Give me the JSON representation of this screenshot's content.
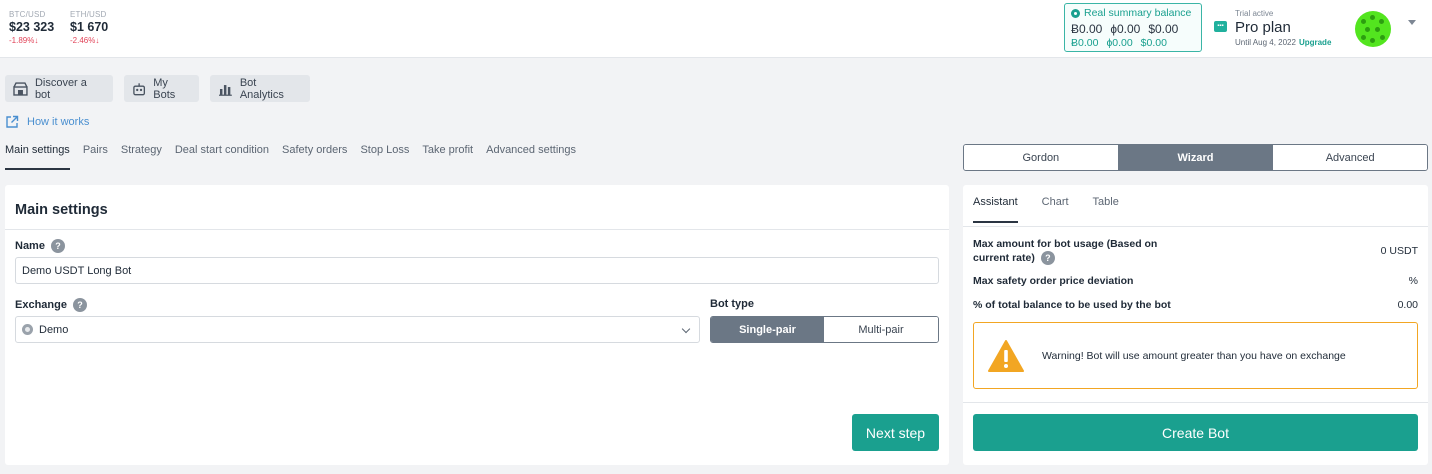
{
  "tickers": [
    {
      "pair": "BTC/USD",
      "price": "$23 323",
      "change": "-1.89%↓"
    },
    {
      "pair": "ETH/USD",
      "price": "$1 670",
      "change": "-2.46%↓"
    }
  ],
  "balance": {
    "title": "Real summary balance",
    "row1": [
      "Ƀ0.00",
      "ɸ0.00",
      "$0.00"
    ],
    "row2": [
      "Ƀ0.00",
      "ɸ0.00",
      "$0.00"
    ]
  },
  "plan": {
    "status": "Trial active",
    "name": "Pro plan",
    "until": "Until Aug 4, 2022",
    "upgrade": "Upgrade"
  },
  "nav": {
    "discover": "Discover a bot",
    "mybots": "My Bots",
    "analytics": "Bot Analytics",
    "howto": "How it works"
  },
  "steps": [
    "Main settings",
    "Pairs",
    "Strategy",
    "Deal start condition",
    "Safety orders",
    "Stop Loss",
    "Take profit",
    "Advanced settings"
  ],
  "main": {
    "title": "Main settings",
    "name_label": "Name",
    "name_value": "Demo USDT Long Bot",
    "exchange_label": "Exchange",
    "exchange_value": "Demo",
    "bottype_label": "Bot type",
    "single_pair": "Single-pair",
    "multi_pair": "Multi-pair",
    "next_step": "Next step"
  },
  "mode": [
    "Gordon",
    "Wizard",
    "Advanced"
  ],
  "right": {
    "tabs": [
      "Assistant",
      "Chart",
      "Table"
    ],
    "max_amount_label_1": "Max amount for bot usage (Based on",
    "max_amount_label_2": "current rate)",
    "max_amount_value": "0 USDT",
    "deviation_label": "Max safety order price deviation",
    "deviation_value": "%",
    "balance_pct_label": "% of total balance to be used by the bot",
    "balance_pct_value": "0.00",
    "warning": "Warning! Bot will use amount greater than you have on exchange",
    "create_bot": "Create Bot"
  },
  "colors": {
    "accent": "#1aa08f",
    "toggle": "#6b7785",
    "warning": "#f2a623"
  }
}
